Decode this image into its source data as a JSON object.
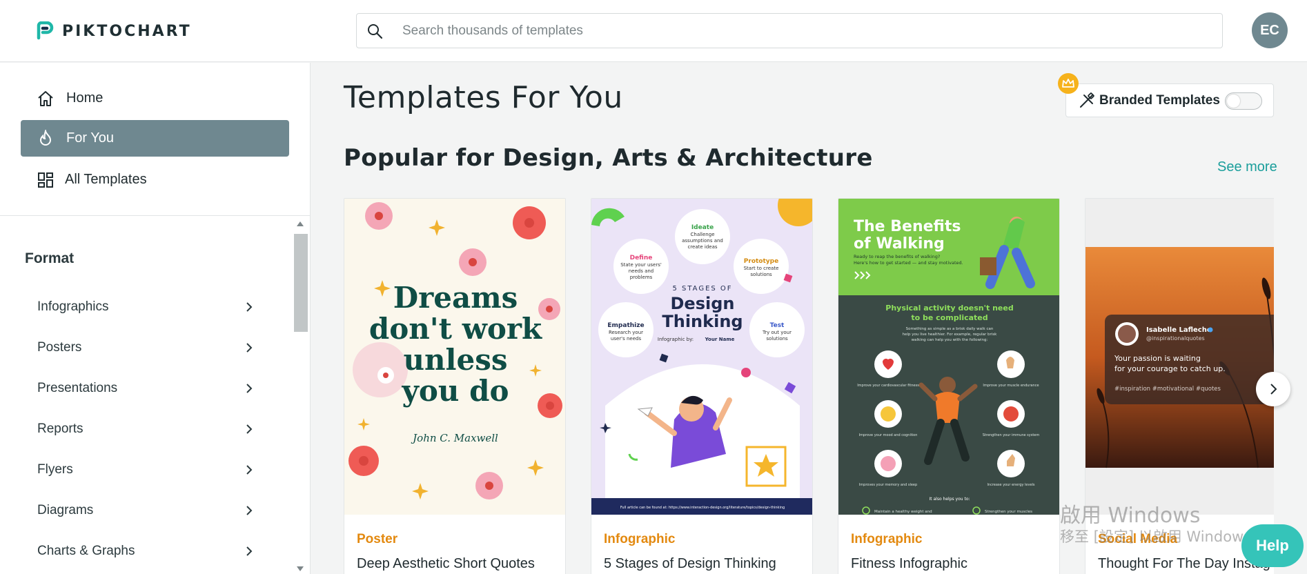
{
  "header": {
    "logo_text": "PIKTOCHART",
    "search_placeholder": "Search thousands of templates",
    "avatar_initials": "EC"
  },
  "sidebar": {
    "nav": [
      {
        "label": "Home",
        "icon": "home-icon"
      },
      {
        "label": "For You",
        "icon": "flame-icon",
        "active": true
      },
      {
        "label": "All Templates",
        "icon": "grid-icon"
      }
    ],
    "format_title": "Format",
    "format_items": [
      {
        "label": "Infographics"
      },
      {
        "label": "Posters"
      },
      {
        "label": "Presentations"
      },
      {
        "label": "Reports"
      },
      {
        "label": "Flyers"
      },
      {
        "label": "Diagrams"
      },
      {
        "label": "Charts & Graphs"
      }
    ]
  },
  "main": {
    "title": "Templates For You",
    "branded_label": "Branded Templates",
    "branded_toggle_on": false,
    "section_title": "Popular for Design, Arts & Architecture",
    "see_more": "See more",
    "cards": [
      {
        "category": "Poster",
        "name": "Deep Aesthetic Short Quotes",
        "thumb": {
          "line1": "Dreams",
          "line2": "don't work",
          "line3": "unless",
          "line4": "you do",
          "author": "John C. Maxwell"
        }
      },
      {
        "category": "Infographic",
        "name": "5 Stages of Design Thinking",
        "thumb": {
          "top": "5 STAGES OF",
          "t1": "Design",
          "t2": "Thinking",
          "by": "Infographic by:",
          "byname": "Your Name",
          "ideate": "Ideate",
          "ideate_sub": "Challenge assumptions and create ideas",
          "define": "Define",
          "define_sub": "State your users' needs and problems",
          "prototype": "Prototype",
          "prototype_sub": "Start to create solutions",
          "empathize": "Empathize",
          "empathize_sub": "Research your user's needs",
          "test": "Test",
          "test_sub": "Try out your solutions",
          "footer": "Full article can be found at: https://www.interaction-design.org/literature/topics/design-thinking"
        }
      },
      {
        "category": "Infographic",
        "name": "Fitness Infographic",
        "thumb": {
          "title1": "The Benefits",
          "title2": "of Walking",
          "sub1": "Ready to reap the benefits of walking?",
          "sub2": "Here's how to get started — and stay motivated.",
          "head1": "Physical activity doesn't need",
          "head2": "to be complicated",
          "body1": "Something as simple as a brisk daily walk can",
          "body2": "help you live healthier. For example, regular brisk",
          "body3": "walking can help you with the following:",
          "b1": "Improve your cardiovascular fitness",
          "b2": "Improve your muscle endurance",
          "b3": "Improve your mood and cognition",
          "b4": "Strengthen your immune system",
          "b5": "Improves your memory and sleep",
          "b6": "Increase your energy levels",
          "also": "It also helps you to:",
          "a1": "Maintain a healthy weight and",
          "a2": "Strengthen your muscles"
        }
      },
      {
        "category": "Social Media",
        "name": "Thought For The Day Instag",
        "thumb": {
          "user": "Isabelle Lafleche",
          "handle": "@inspirationalquotes",
          "quote1": "Your passion is waiting",
          "quote2": "for your courage to catch up.",
          "tags": "#inspiration  #motivational  #quotes"
        }
      }
    ]
  },
  "overlay": {
    "watermark_line1": "啟用 Windows",
    "watermark_line2": "移至 [設定] 以啟用 Windows。",
    "help_label": "Help"
  },
  "colors": {
    "accent": "#1a9e9b",
    "active_nav": "#6f8890",
    "category": "#e3890f",
    "help": "#35c4b9"
  }
}
